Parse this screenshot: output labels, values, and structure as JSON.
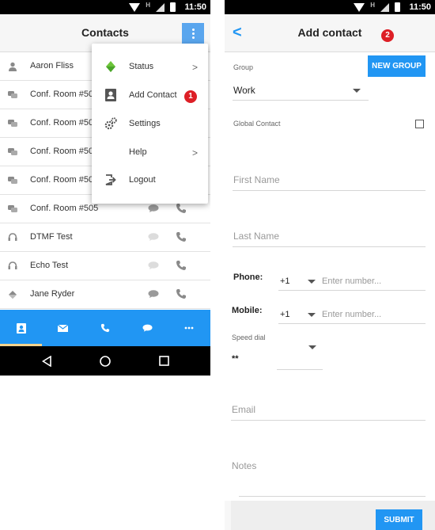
{
  "status_bar": {
    "time": "11:50",
    "network": "H"
  },
  "contacts_screen": {
    "title": "Contacts",
    "contacts": [
      {
        "name": "Aaron Fliss",
        "icon": "person-icon"
      },
      {
        "name": "Conf. Room #501",
        "icon": "chat-group-icon"
      },
      {
        "name": "Conf. Room #502",
        "icon": "chat-group-icon"
      },
      {
        "name": "Conf. Room #503",
        "icon": "chat-group-icon"
      },
      {
        "name": "Conf. Room #504",
        "icon": "chat-group-icon"
      },
      {
        "name": "Conf. Room #505",
        "icon": "chat-group-icon"
      },
      {
        "name": "DTMF Test",
        "icon": "headset-icon"
      },
      {
        "name": "Echo Test",
        "icon": "headset-icon"
      },
      {
        "name": "Jane Ryder",
        "icon": "status-diamond-icon"
      }
    ],
    "menu": {
      "items": [
        {
          "label": "Status",
          "icon": "status-dot-icon",
          "chevron": ">"
        },
        {
          "label": "Add Contact",
          "icon": "contact-book-icon",
          "chevron": ""
        },
        {
          "label": "Settings",
          "icon": "gears-icon",
          "chevron": ""
        },
        {
          "label": "Help",
          "icon": "",
          "chevron": ">"
        },
        {
          "label": "Logout",
          "icon": "logout-icon",
          "chevron": ""
        }
      ],
      "callout": "1"
    },
    "bottom_tabs": [
      "contacts-tab-icon",
      "messages-tab-icon",
      "calls-tab-icon",
      "chat-tab-icon",
      "more-tab-icon"
    ]
  },
  "add_contact_screen": {
    "title": "Add contact",
    "back": "<",
    "callout": "2",
    "group_label": "Group",
    "new_group_button": "NEW GROUP",
    "group_value": "Work",
    "global_contact_label": "Global Contact",
    "first_name_placeholder": "First Name",
    "last_name_placeholder": "Last Name",
    "phone_label": "Phone:",
    "phone_country_code": "+1",
    "phone_placeholder": "Enter number...",
    "mobile_label": "Mobile:",
    "mobile_country_code": "+1",
    "mobile_placeholder": "Enter number...",
    "speed_dial_label": "Speed dial",
    "speed_dial_prefix": "**",
    "email_placeholder": "Email",
    "notes_placeholder": "Notes",
    "submit_button": "SUBMIT"
  },
  "colors": {
    "accent": "#2196f3",
    "badge": "#dd1f26",
    "status_green": "#6cc43a"
  }
}
